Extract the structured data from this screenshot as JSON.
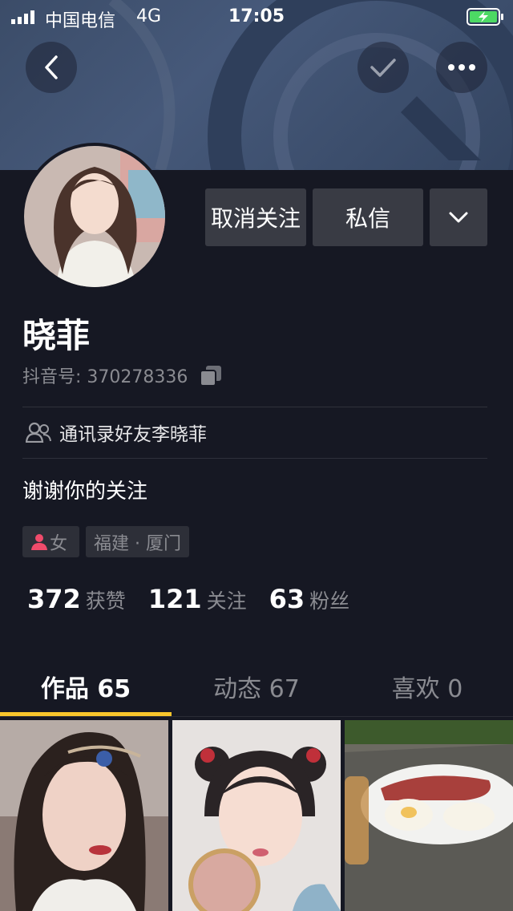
{
  "status_bar": {
    "carrier": "中国电信",
    "network": "4G",
    "time": "17:05"
  },
  "profile": {
    "name": "晓菲",
    "douyin_id": "抖音号: 370278336",
    "contact_note": "通讯录好友李晓菲",
    "bio": "谢谢你的关注"
  },
  "actions": {
    "unfollow": "取消关注",
    "message": "私信"
  },
  "tags": {
    "gender": "女",
    "location": "福建 · 厦门"
  },
  "stats": [
    {
      "num": "372",
      "label": "获赞"
    },
    {
      "num": "121",
      "label": "关注"
    },
    {
      "num": "63",
      "label": "粉丝"
    }
  ],
  "tabs": [
    {
      "label": "作品 65"
    },
    {
      "label": "动态 67"
    },
    {
      "label": "喜欢 0"
    }
  ],
  "colors": {
    "background": "#161823",
    "accent": "#f8c52c",
    "female_icon": "#f04b6b",
    "battery": "#4cd964"
  }
}
